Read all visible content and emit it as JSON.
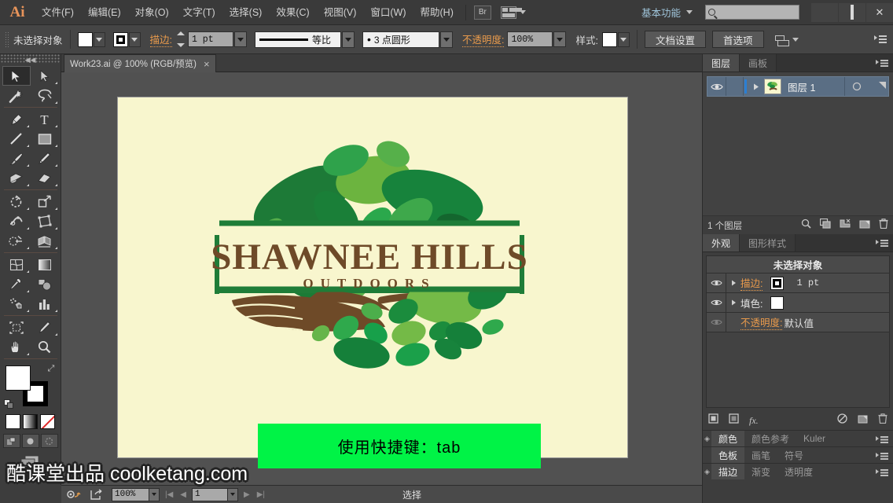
{
  "app": {
    "logo": "Ai",
    "menus": [
      "文件(F)",
      "编辑(E)",
      "对象(O)",
      "文字(T)",
      "选择(S)",
      "效果(C)",
      "视图(V)",
      "窗口(W)",
      "帮助(H)"
    ],
    "bridge_button": "Br",
    "workspace": "基本功能",
    "search_placeholder": "",
    "window_buttons": {
      "minimize": "",
      "maximize": "",
      "close": "✕"
    }
  },
  "control_bar": {
    "selection_status": "未选择对象",
    "stroke_label": "描边:",
    "stroke_weight": "1 pt",
    "profile_label": "等比",
    "brush_label": "3 点圆形",
    "opacity_label": "不透明度:",
    "opacity_value": "100%",
    "style_label": "样式:",
    "doc_setup_button": "文档设置",
    "preferences_button": "首选项"
  },
  "document_tab": {
    "title": "Work23.ai @ 100% (RGB/预览)",
    "close": "×"
  },
  "toolbox": {
    "tools": [
      "selection-tool",
      "direct-selection-tool",
      "magic-wand-tool",
      "lasso-tool",
      "pen-tool",
      "type-tool",
      "line-segment-tool",
      "rectangle-tool",
      "paintbrush-tool",
      "pencil-tool",
      "blob-brush-tool",
      "eraser-tool",
      "rotate-tool",
      "scale-tool",
      "width-tool",
      "free-transform-tool",
      "shape-builder-tool",
      "perspective-grid-tool",
      "mesh-tool",
      "gradient-tool",
      "eyedropper-tool",
      "blend-tool",
      "symbol-sprayer-tool",
      "column-graph-tool",
      "artboard-tool",
      "slice-tool",
      "hand-tool",
      "zoom-tool"
    ],
    "fill_color": "#FFFFFF",
    "stroke_color": "#000000"
  },
  "canvas": {
    "artboard_background": "#F8F6CE",
    "logo": {
      "title_line1": "SHAWNEE HILLS",
      "title_line2": "OUTDOORS",
      "brown": "#6E4A28",
      "greens": [
        "#1D8A3E",
        "#2FA84F",
        "#66B94A",
        "#8CC63F",
        "#0F7A35",
        "#4FAE4A"
      ]
    },
    "banner": {
      "text": "使用快捷键：tab",
      "background": "#00F346",
      "text_color": "#000000"
    }
  },
  "watermark": "酷课堂出品 coolketang.com",
  "layers_panel": {
    "tabs": [
      "图层",
      "画板"
    ],
    "active_tab": "图层",
    "rows": [
      {
        "name": "图层 1",
        "visible": true,
        "selected": true
      }
    ],
    "footer_count": "1 个图层",
    "footer_icons": [
      "locate-object-icon",
      "make-clipping-mask-icon",
      "create-new-sublayer-icon",
      "create-new-layer-icon",
      "delete-selection-icon"
    ]
  },
  "appearance_panel": {
    "tabs": [
      "外观",
      "图形样式"
    ],
    "active_tab": "外观",
    "header": "未选择对象",
    "rows": [
      {
        "label": "描边:",
        "value": "1 pt",
        "orange": true,
        "swatch": "stroke"
      },
      {
        "label": "填色:",
        "value": "",
        "orange": false,
        "swatch": "fill"
      },
      {
        "label": "不透明度:",
        "value": "默认值",
        "orange": true,
        "swatch": "none"
      }
    ],
    "footer_icons": [
      "add-new-stroke-icon",
      "add-new-fill-icon",
      "add-effect-icon",
      "clear-appearance-icon",
      "duplicate-item-icon",
      "delete-item-icon"
    ]
  },
  "collapsed_panels": [
    {
      "tabs": [
        "颜色",
        "颜色参考",
        "Kuler"
      ],
      "active": "颜色",
      "has_grip": true
    },
    {
      "tabs": [
        "色板",
        "画笔",
        "符号"
      ],
      "active": "色板",
      "has_grip": false
    },
    {
      "tabs": [
        "描边",
        "渐变",
        "透明度"
      ],
      "active": "描边",
      "has_grip": true
    }
  ],
  "status_bar": {
    "zoom": "100%",
    "page": "1",
    "tool_status": "选择"
  }
}
